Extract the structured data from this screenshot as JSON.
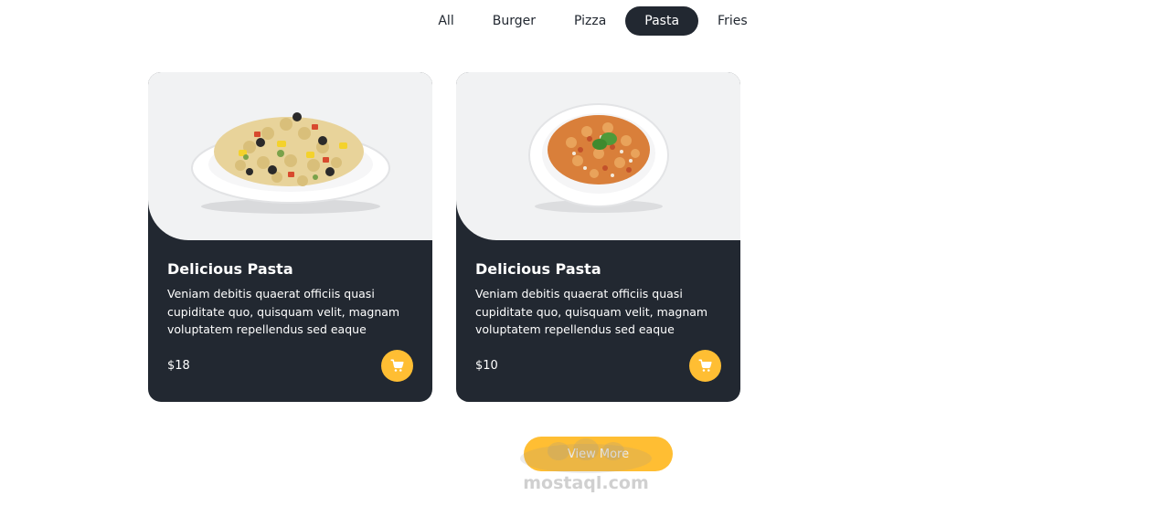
{
  "filters": {
    "items": [
      {
        "label": "All"
      },
      {
        "label": "Burger"
      },
      {
        "label": "Pizza"
      },
      {
        "label": "Pasta"
      },
      {
        "label": "Fries"
      }
    ],
    "active": "Pasta"
  },
  "menu": {
    "items": [
      {
        "title": "Delicious Pasta",
        "description": "Veniam debitis quaerat officiis quasi cupiditate quo, quisquam velit, magnam voluptatem repellendus sed eaque",
        "price": "$18",
        "image": "pasta-salad-plate"
      },
      {
        "title": "Delicious Pasta",
        "description": "Veniam debitis quaerat officiis quasi cupiditate quo, quisquam velit, magnam voluptatem repellendus sed eaque",
        "price": "$10",
        "image": "pasta-bowl-with-basil"
      }
    ]
  },
  "view_more": {
    "label": "View More"
  },
  "watermark": {
    "text": "mostaql.com"
  },
  "colors": {
    "dark": "#222831",
    "accent": "#ffbe33",
    "image_bg": "#f1f2f3"
  },
  "icons": {
    "cart": "shopping-cart-icon"
  }
}
